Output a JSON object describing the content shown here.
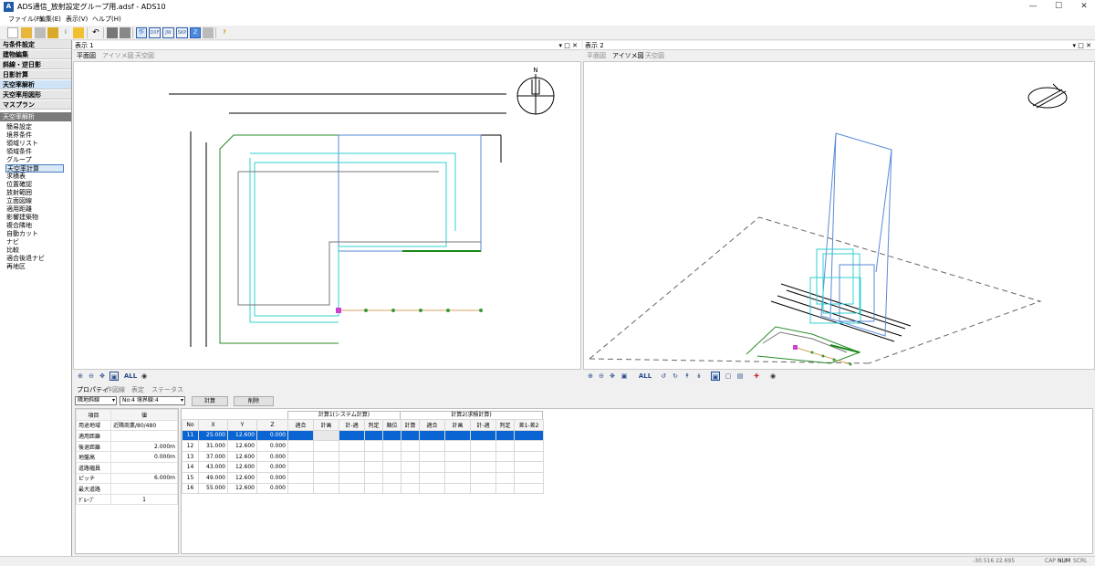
{
  "window": {
    "title": "ADS通信_放射設定グループ用.adsf - ADS10"
  },
  "menu": [
    "ファイル(F)",
    "編集(E)",
    "表示(V)",
    "ヘルプ(H)"
  ],
  "toolbar": {
    "dxf": "DXF",
    "jw": "JW",
    "skp": "SKP"
  },
  "left": {
    "headers": [
      "与条件設定",
      "建物編集",
      "斜線・逆日影",
      "日影計算",
      "天空率解析",
      "天空率用図形",
      "マスプラン"
    ],
    "section": "天空率解析",
    "items": [
      "簡易設定",
      "境界条件",
      "領域リスト",
      "領域条件",
      "グループ",
      "天空率計算",
      "求積表",
      "位置確認",
      "放射範囲",
      "立面図線",
      "適用距離",
      "影響建築物",
      "複合隣地",
      "自動カット",
      "ナビ",
      "比較",
      "適合後退ナビ",
      "再地区"
    ]
  },
  "view1": {
    "title": "表示 1",
    "tabs": [
      "平面図",
      "アイソメ図",
      "天空図"
    ]
  },
  "view2": {
    "title": "表示 2",
    "tabs": [
      "平面図",
      "アイソメ図",
      "天空図"
    ]
  },
  "compass": {
    "north": "N"
  },
  "viewtool": {
    "all": "ALL"
  },
  "bottom": {
    "tabs": [
      "プロパティ",
      "作図線",
      "表定",
      "ステータス"
    ],
    "select1": "隣地斜線",
    "select2": "No:4 境界線:4",
    "calc_button": "計算",
    "delete_button": "削除",
    "prop_headers": [
      "項目",
      "値"
    ],
    "props": [
      [
        "用途地域",
        "近隣商業/80/480"
      ],
      [
        "適用距離",
        ""
      ],
      [
        "後退距離",
        "2.000m"
      ],
      [
        "地盤高",
        "0.000m"
      ],
      [
        "道路幅員",
        ""
      ],
      [
        "ピッチ",
        "6.000m"
      ],
      [
        "最大道路",
        ""
      ],
      [
        "ｸﾞﾙｰﾌﾟ",
        "1"
      ]
    ],
    "group1": "計算1(システム計算)",
    "group2": "計算2(求積計算)",
    "grid_headers": [
      "No",
      "X",
      "Y",
      "Z",
      "適合",
      "計画",
      "計-適",
      "判定",
      "順位",
      "計算",
      "適合",
      "計画",
      "計-適",
      "判定",
      "差1-差2"
    ],
    "rows": [
      [
        "11",
        "25.000",
        "12.600",
        "0.000"
      ],
      [
        "12",
        "31.000",
        "12.600",
        "0.000"
      ],
      [
        "13",
        "37.000",
        "12.600",
        "0.000"
      ],
      [
        "14",
        "43.000",
        "12.600",
        "0.000"
      ],
      [
        "15",
        "49.000",
        "12.600",
        "0.000"
      ],
      [
        "16",
        "55.000",
        "12.600",
        "0.000"
      ]
    ]
  },
  "status": {
    "coords": "-30.516 22.695",
    "cap": "CAP",
    "num": "NUM",
    "scrl": "SCRL"
  }
}
